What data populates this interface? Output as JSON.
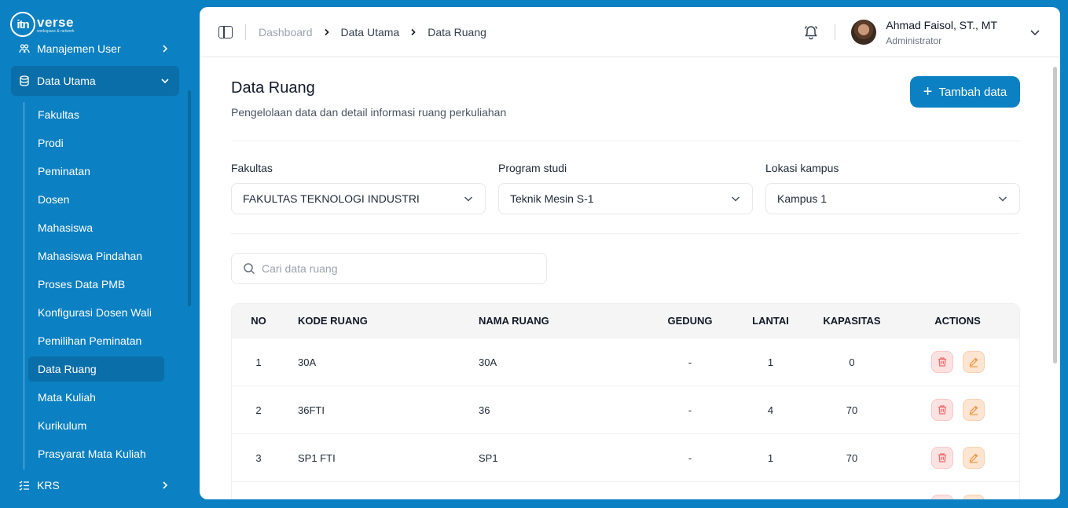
{
  "app": {
    "logo_mark": "itn",
    "logo_text": "verse",
    "logo_tagline": "workspace & network"
  },
  "sidebar": {
    "groups": [
      {
        "label": "Manajemen User"
      },
      {
        "label": "Data Utama"
      },
      {
        "label": "KRS"
      }
    ],
    "sub_items": [
      {
        "label": "Fakultas"
      },
      {
        "label": "Prodi"
      },
      {
        "label": "Peminatan"
      },
      {
        "label": "Dosen"
      },
      {
        "label": "Mahasiswa"
      },
      {
        "label": "Mahasiswa Pindahan"
      },
      {
        "label": "Proses Data PMB"
      },
      {
        "label": "Konfigurasi Dosen Wali"
      },
      {
        "label": "Pemilihan Peminatan"
      },
      {
        "label": "Data Ruang"
      },
      {
        "label": "Mata Kuliah"
      },
      {
        "label": "Kurikulum"
      },
      {
        "label": "Prasyarat Mata Kuliah"
      }
    ]
  },
  "header": {
    "breadcrumbs": [
      "Dashboard",
      "Data Utama",
      "Data Ruang"
    ],
    "user_name": "Ahmad Faisol, ST., MT",
    "user_role": "Administrator"
  },
  "page": {
    "title": "Data Ruang",
    "description": "Pengelolaan data dan detail informasi ruang perkuliahan",
    "add_button": "Tambah data"
  },
  "filters": {
    "fakultas": {
      "label": "Fakultas",
      "value": "FAKULTAS TEKNOLOGI INDUSTRI"
    },
    "prodi": {
      "label": "Program studi",
      "value": "Teknik Mesin S-1"
    },
    "lokasi": {
      "label": "Lokasi kampus",
      "value": "Kampus 1"
    }
  },
  "search": {
    "placeholder": "Cari data ruang"
  },
  "table": {
    "headers": [
      "NO",
      "KODE RUANG",
      "NAMA RUANG",
      "GEDUNG",
      "LANTAI",
      "KAPASITAS",
      "ACTIONS"
    ],
    "rows": [
      {
        "no": "1",
        "kode": "30A",
        "nama": "30A",
        "gedung": "-",
        "lantai": "1",
        "kapasitas": "0"
      },
      {
        "no": "2",
        "kode": "36FTI",
        "nama": "36",
        "gedung": "-",
        "lantai": "4",
        "kapasitas": "70"
      },
      {
        "no": "3",
        "kode": "SP1 FTI",
        "nama": "SP1",
        "gedung": "-",
        "lantai": "1",
        "kapasitas": "70"
      }
    ]
  },
  "colors": {
    "brand": "#0b80c2",
    "sidebar_active": "#0a6ea8",
    "delete_icon": "#ef6b6b",
    "edit_icon": "#f29a4a"
  }
}
